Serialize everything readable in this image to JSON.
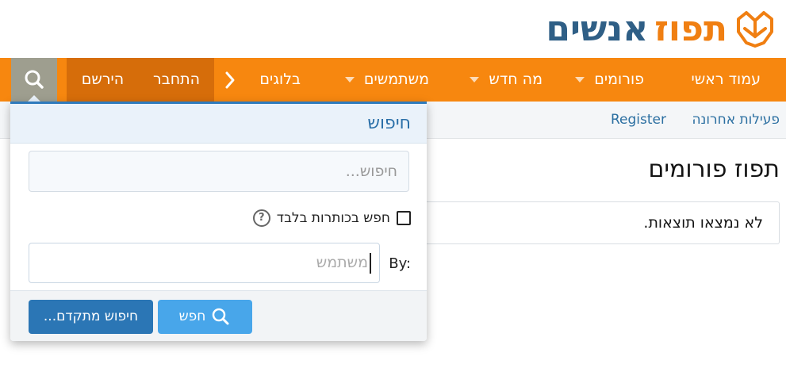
{
  "logo": {
    "orange_text": "תפוז",
    "blue_text": "אנשים",
    "orange": "#f07f12",
    "blue": "#2f5f86"
  },
  "nav": {
    "home": "עמוד ראשי",
    "forums": "פורומים",
    "whats_new": "מה חדש",
    "members": "משתמשים",
    "blogs": "בלוגים",
    "more_icon": "chevron-right-icon",
    "login": "התחבר",
    "register": "הירשם",
    "search_icon": "search-icon",
    "bg": "#f7870f"
  },
  "subnav": {
    "recent": "פעילות אחרונה",
    "register": "Register"
  },
  "main": {
    "title": "תפוז פורומים",
    "no_results": "לא נמצאו תוצאות."
  },
  "search_panel": {
    "title": "חיפוש",
    "keywords_placeholder": "חיפוש...",
    "titles_only_label": "חפש בכותרות בלבד",
    "titles_only_checked": false,
    "by_label": "By:",
    "user_placeholder": "משתמש",
    "search_button": "חפש",
    "advanced_button": "חיפוש מתקדם..."
  }
}
